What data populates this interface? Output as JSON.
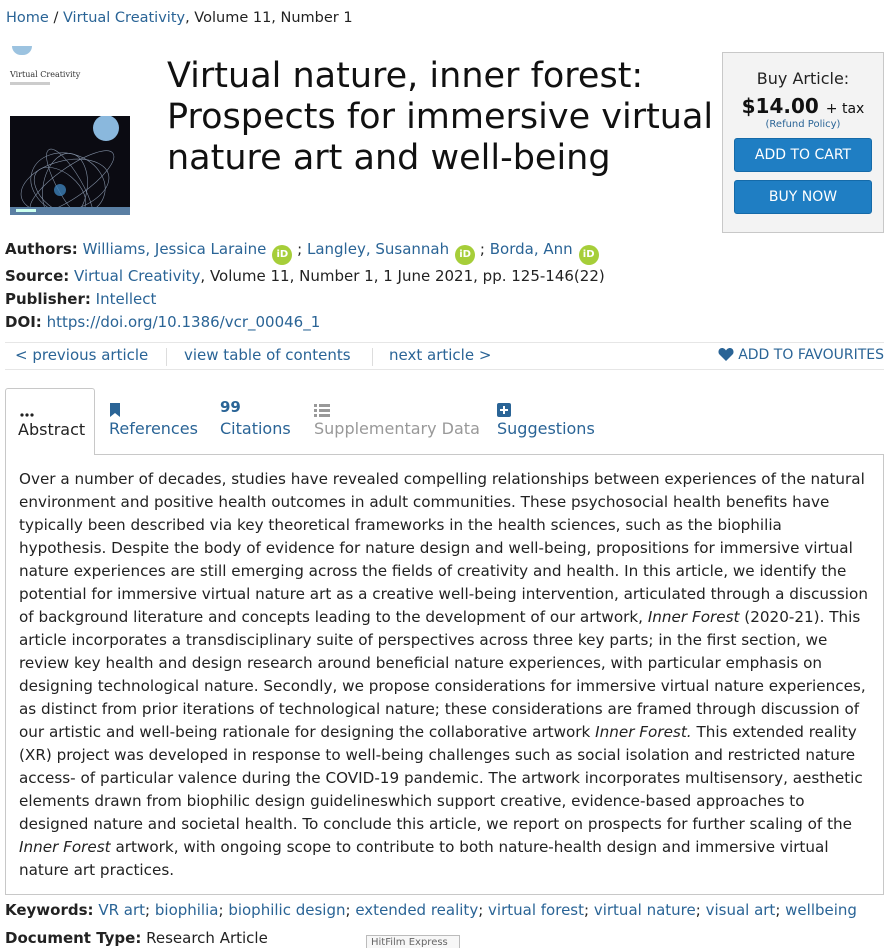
{
  "breadcrumb": {
    "home": "Home",
    "sep": "/",
    "journal": "Virtual Creativity",
    "issue": ", Volume 11, Number 1"
  },
  "cover": {
    "journal_title": "Virtual Creativity"
  },
  "article": {
    "title_line1": "Virtual nature, inner forest:",
    "title_line2": "Prospects for immersive virtual",
    "title_line3": "nature art and well-being"
  },
  "buy": {
    "label": "Buy Article:",
    "price": "$14.00",
    "tax": "+ tax",
    "refund": "(Refund Policy)",
    "add_to_cart": "ADD TO CART",
    "buy_now": "BUY NOW"
  },
  "meta": {
    "authors_label": "Authors:",
    "authors": [
      "Williams, Jessica Laraine",
      "Langley, Susannah",
      "Borda, Ann"
    ],
    "author_sep": ";",
    "orcid_label": "iD",
    "source_label": "Source:",
    "source_journal": "Virtual Creativity",
    "source_rest": ", Volume 11, Number 1, 1 June 2021, pp. 125-146(22)",
    "publisher_label": "Publisher:",
    "publisher": "Intellect",
    "doi_label": "DOI:",
    "doi": "https://doi.org/10.1386/vcr_00046_1"
  },
  "nav": {
    "previous": "< previous article",
    "toc": "view table of contents",
    "next": "next article >",
    "favourites": "ADD TO FAVOURITES"
  },
  "tabs": {
    "abstract": "Abstract",
    "references": "References",
    "citations": "Citations",
    "supplementary": "Supplementary Data",
    "suggestions": "Suggestions",
    "citations_icon_text": "99"
  },
  "abstract": {
    "p1": "Over a number of decades, studies have revealed compelling relationships between experiences of the natural environment and positive health outcomes in adult communities. These psychosocial health benefits have typically been described via key theoretical frameworks in the health sciences, such as the biophilia hypothesis. Despite the body of evidence for nature design and well-being, propositions for immersive virtual nature experiences are still emerging across the fields of creativity and health. In this article, we identify the potential for immersive virtual nature art as a creative well-being intervention, articulated through a discussion of background literature and concepts leading to the development of our artwork, ",
    "work1": "Inner Forest",
    "p2": " (2020-21). This article incorporates a transdisciplinary suite of perspectives across three key parts; in the first section, we review key health and design research around beneficial nature experiences, with particular emphasis on designing technological nature. Secondly, we propose considerations for immersive virtual nature experiences, as distinct from prior iterations of technological nature; these considerations are framed through discussion of our artistic and well-being rationale for designing the collaborative artwork ",
    "work2": "Inner Forest.",
    "p3": " This extended reality (XR) project was developed in response to well-being challenges such as social isolation and restricted nature access- of particular valence during the COVID-19 pandemic. The artwork incorporates multisensory, aesthetic elements drawn from biophilic design guidelineswhich support creative, evidence-based approaches to designed nature and societal health. To conclude this article, we report on prospects for further scaling of the ",
    "work3": "Inner Forest",
    "p4": " artwork, with ongoing scope to contribute to both nature-health design and immersive virtual nature art practices."
  },
  "keywords": {
    "label": "Keywords:",
    "sep": ";",
    "items": [
      "VR art",
      "biophilia",
      "biophilic design",
      "extended reality",
      "virtual forest",
      "virtual nature",
      "visual art",
      "wellbeing"
    ]
  },
  "doctype": {
    "label": "Document Type:",
    "value": "Research Article"
  },
  "overlay": {
    "hitfilm": "HitFilm Express"
  }
}
